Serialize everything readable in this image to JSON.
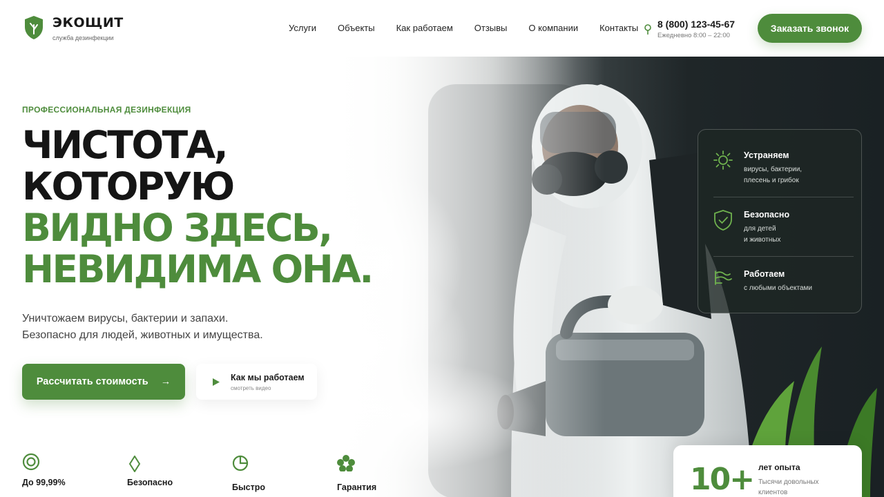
{
  "brand": {
    "name": "ЭКОЩИТ",
    "tagline": "служба дезинфекции"
  },
  "nav": [
    "Услуги",
    "Объекты",
    "Как работаем",
    "Отзывы",
    "О компании",
    "Контакты"
  ],
  "contact": {
    "phone": "8 (800) 123-45-67",
    "hours": "Ежедневно 8:00 – 22:00"
  },
  "header": {
    "cta_label": "Заказать звонок"
  },
  "hero": {
    "eyebrow": "ПРОФЕССИОНАЛЬНАЯ ДЕЗИНФЕКЦИЯ",
    "headline_dark": [
      "ЧИСТОТА,",
      "КОТОРУЮ"
    ],
    "headline_green": [
      "ВИДНО ЗДЕСЬ,",
      "НЕВИДИМА ОНА."
    ],
    "lead": [
      "Уничтожаем вирусы, бактерии и запахи.",
      "Безопасно для людей, животных и имущества."
    ],
    "cta_label": "Рассчитать стоимость",
    "cta_arrow": "→",
    "video_title": "Как мы работаем",
    "video_sub": "смотреть видео"
  },
  "features": [
    {
      "icon": "target-icon",
      "label": "До 99,99%"
    },
    {
      "icon": "diamond-icon",
      "label": "Безопасно"
    },
    {
      "icon": "clock-pie-icon",
      "label": "Быстро"
    },
    {
      "icon": "flower-icon",
      "label": "Гарантия"
    }
  ],
  "benefits": [
    {
      "icon": "virus-icon",
      "title": "Устраняем",
      "desc": "вирусы, бактерии,\nплесень и грибок"
    },
    {
      "icon": "shield-check-icon",
      "title": "Безопасно",
      "desc": "для детей\nи животных"
    },
    {
      "icon": "wind-icon",
      "title": "Работаем",
      "desc": "с любыми объектами"
    }
  ],
  "experience": {
    "value": "10+",
    "title": "лет опыта",
    "desc": "Тысячи довольных клиентов"
  },
  "colors": {
    "accent": "#4e8c3c",
    "dark": "#151515"
  }
}
